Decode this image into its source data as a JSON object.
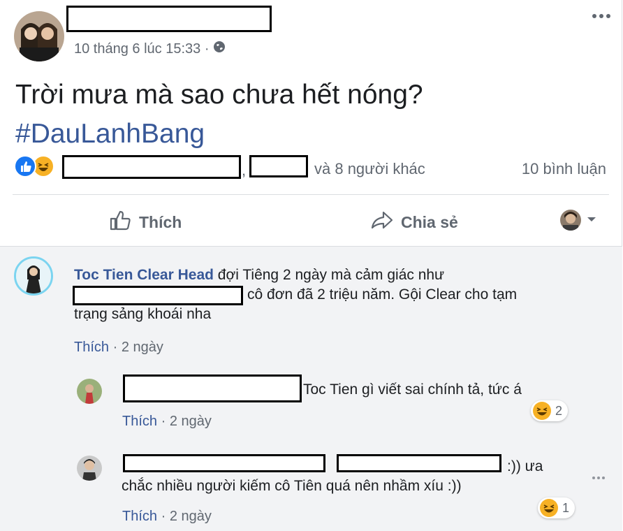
{
  "post": {
    "timestamp": "10 tháng 6 lúc 15:33 ·",
    "text": "Trời mưa mà sao chưa hết nóng?",
    "hashtag": "#DauLanhBang",
    "likers_suffix": "và 8 người khác",
    "comment_count": "10 bình luận"
  },
  "actions": {
    "like": "Thích",
    "share": "Chia sẻ"
  },
  "comments": [
    {
      "author": "Toc Tien Clear Head",
      "text_part1": " đợi Tiêng 2 ngày mà cảm giác như",
      "text_part2": "cô đơn đã 2 triệu năm. Gội Clear cho tạm",
      "text_part3": "trạng sảng khoái nha",
      "like_label": "Thích",
      "time": "2 ngày"
    }
  ],
  "replies": [
    {
      "text": "Toc Tien gì viết sai chính tả, tức á",
      "reaction_count": "2",
      "like_label": "Thích",
      "time": "2 ngày"
    },
    {
      "text_part1": ":)) ưa",
      "text_part2": "chắc nhiều người kiếm cô Tiên quá nên nhầm xíu :))",
      "reaction_count": "1",
      "like_label": "Thích",
      "time": "2 ngày"
    }
  ],
  "colors": {
    "link_blue": "#385898",
    "like_blue": "#1877f2",
    "haha_yellow": "#f7b125",
    "meta_grey": "#606770"
  }
}
